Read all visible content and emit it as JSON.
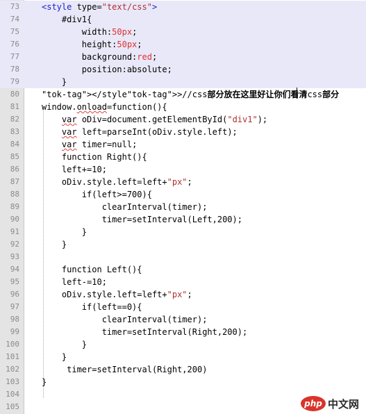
{
  "editor": {
    "lines": [
      {
        "n": "73",
        "code": "<style type=\"text/css\">"
      },
      {
        "n": "74",
        "code": "    #div1{"
      },
      {
        "n": "75",
        "code": "        width:50px;"
      },
      {
        "n": "76",
        "code": "        height:50px;"
      },
      {
        "n": "77",
        "code": "        background:red;"
      },
      {
        "n": "78",
        "code": "        position:absolute;"
      },
      {
        "n": "79",
        "code": "    }"
      },
      {
        "n": "80",
        "code": "</style>//css部分放在这里好让你们看清css部分"
      },
      {
        "n": "81",
        "code": "window.onload=function(){"
      },
      {
        "n": "82",
        "code": "    var oDiv=document.getElementById(\"div1\");"
      },
      {
        "n": "83",
        "code": "    var left=parseInt(oDiv.style.left);"
      },
      {
        "n": "84",
        "code": "    var timer=null;"
      },
      {
        "n": "85",
        "code": "    function Right(){"
      },
      {
        "n": "86",
        "code": "    left+=10;"
      },
      {
        "n": "87",
        "code": "    oDiv.style.left=left+\"px\";"
      },
      {
        "n": "88",
        "code": "        if(left>=700){"
      },
      {
        "n": "89",
        "code": "            clearInterval(timer);"
      },
      {
        "n": "90",
        "code": "            timer=setInterval(Left,200);"
      },
      {
        "n": "91",
        "code": "        }"
      },
      {
        "n": "92",
        "code": "    }"
      },
      {
        "n": "93",
        "code": ""
      },
      {
        "n": "94",
        "code": "    function Left(){"
      },
      {
        "n": "95",
        "code": "    left-=10;"
      },
      {
        "n": "96",
        "code": "    oDiv.style.left=left+\"px\";"
      },
      {
        "n": "97",
        "code": "        if(left==0){"
      },
      {
        "n": "98",
        "code": "            clearInterval(timer);"
      },
      {
        "n": "99",
        "code": "            timer=setInterval(Right,200);"
      },
      {
        "n": "100",
        "code": "        }"
      },
      {
        "n": "101",
        "code": "    }"
      },
      {
        "n": "102",
        "code": "     timer=setInterval(Right,200)"
      },
      {
        "n": "103",
        "code": "}"
      },
      {
        "n": "104",
        "code": ""
      },
      {
        "n": "105",
        "code": ""
      }
    ]
  },
  "watermark": {
    "logo": "php",
    "text": "中文网"
  },
  "colors": {
    "gutter": "#e4e4e4",
    "highlight": "#e8e8f8",
    "string": "#b03030",
    "number": "#e03030",
    "tag": "#2020d0",
    "fold_marker": "#d05050"
  }
}
